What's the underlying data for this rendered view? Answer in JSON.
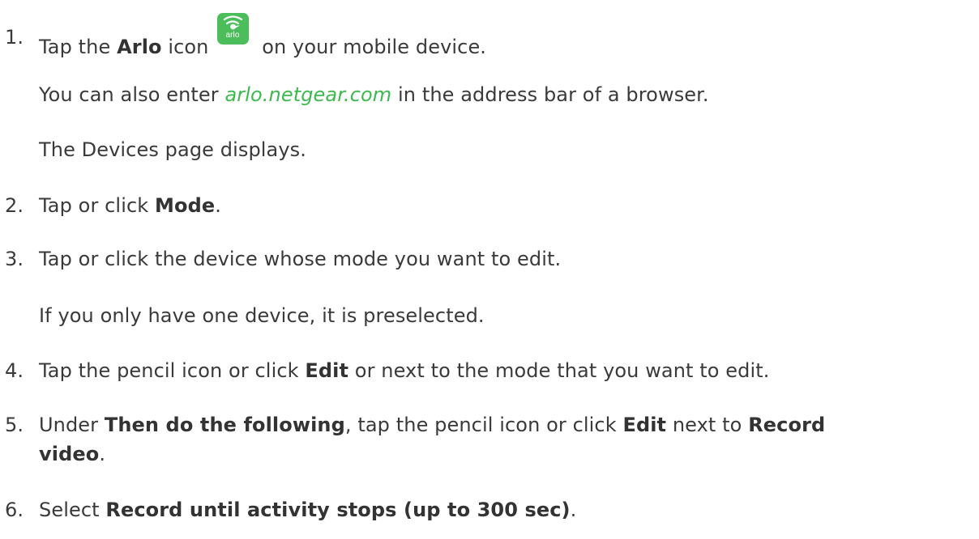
{
  "steps": [
    {
      "num": "1.",
      "before": "Tap the ",
      "bold": "Arlo",
      "after_bold": " icon",
      "after_icon": " on your mobile device.",
      "icon_label": "arlo"
    },
    {
      "num": "2.",
      "before": "Tap or click ",
      "bold": "Mode",
      "after": "."
    },
    {
      "num": "3.",
      "text": "Tap or click the device whose mode you want to edit."
    },
    {
      "num": "4.",
      "before": "Tap the pencil icon or click ",
      "bold": "Edit",
      "after": " or next to the mode that you want to edit."
    },
    {
      "num": "5.",
      "before": "Under ",
      "bold1": "Then do the following",
      "mid": ", tap the pencil icon or click ",
      "bold2": "Edit",
      "mid2": " next to ",
      "bold3": "Record",
      "line2_bold": "video",
      "line2_after": "."
    },
    {
      "num": "6.",
      "before": "Select ",
      "bold": "Record until activity stops (up to 300 sec)",
      "after": "."
    }
  ],
  "notes": {
    "browser_before": "You can also enter ",
    "browser_link": "arlo.netgear.com",
    "browser_after": " in the address bar of a browser.",
    "devices_page": "The Devices page displays.",
    "preselected": "If you only have one device, it is preselected."
  },
  "colors": {
    "text": "#3a3a3a",
    "link": "#3dba4e",
    "icon_bg": "#4bbd5a"
  },
  "icons": {
    "app_icon": "arlo-bird-icon"
  }
}
